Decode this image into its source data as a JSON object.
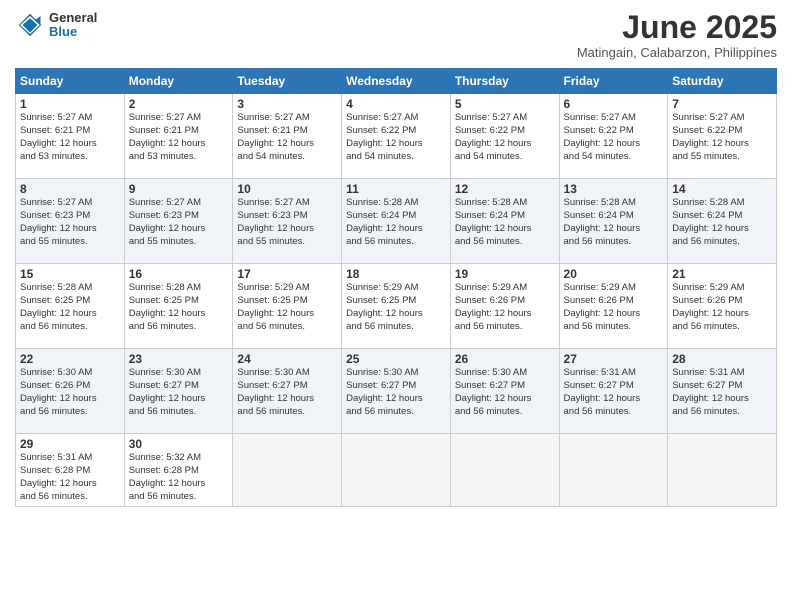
{
  "header": {
    "logo_general": "General",
    "logo_blue": "Blue",
    "month_title": "June 2025",
    "location": "Matingain, Calabarzon, Philippines"
  },
  "days_of_week": [
    "Sunday",
    "Monday",
    "Tuesday",
    "Wednesday",
    "Thursday",
    "Friday",
    "Saturday"
  ],
  "weeks": [
    [
      {
        "day": "1",
        "sunrise": "5:27 AM",
        "sunset": "6:21 PM",
        "daylight": "12 hours and 53 minutes."
      },
      {
        "day": "2",
        "sunrise": "5:27 AM",
        "sunset": "6:21 PM",
        "daylight": "12 hours and 53 minutes."
      },
      {
        "day": "3",
        "sunrise": "5:27 AM",
        "sunset": "6:21 PM",
        "daylight": "12 hours and 54 minutes."
      },
      {
        "day": "4",
        "sunrise": "5:27 AM",
        "sunset": "6:22 PM",
        "daylight": "12 hours and 54 minutes."
      },
      {
        "day": "5",
        "sunrise": "5:27 AM",
        "sunset": "6:22 PM",
        "daylight": "12 hours and 54 minutes."
      },
      {
        "day": "6",
        "sunrise": "5:27 AM",
        "sunset": "6:22 PM",
        "daylight": "12 hours and 54 minutes."
      },
      {
        "day": "7",
        "sunrise": "5:27 AM",
        "sunset": "6:22 PM",
        "daylight": "12 hours and 55 minutes."
      }
    ],
    [
      {
        "day": "8",
        "sunrise": "5:27 AM",
        "sunset": "6:23 PM",
        "daylight": "12 hours and 55 minutes."
      },
      {
        "day": "9",
        "sunrise": "5:27 AM",
        "sunset": "6:23 PM",
        "daylight": "12 hours and 55 minutes."
      },
      {
        "day": "10",
        "sunrise": "5:27 AM",
        "sunset": "6:23 PM",
        "daylight": "12 hours and 55 minutes."
      },
      {
        "day": "11",
        "sunrise": "5:28 AM",
        "sunset": "6:24 PM",
        "daylight": "12 hours and 56 minutes."
      },
      {
        "day": "12",
        "sunrise": "5:28 AM",
        "sunset": "6:24 PM",
        "daylight": "12 hours and 56 minutes."
      },
      {
        "day": "13",
        "sunrise": "5:28 AM",
        "sunset": "6:24 PM",
        "daylight": "12 hours and 56 minutes."
      },
      {
        "day": "14",
        "sunrise": "5:28 AM",
        "sunset": "6:24 PM",
        "daylight": "12 hours and 56 minutes."
      }
    ],
    [
      {
        "day": "15",
        "sunrise": "5:28 AM",
        "sunset": "6:25 PM",
        "daylight": "12 hours and 56 minutes."
      },
      {
        "day": "16",
        "sunrise": "5:28 AM",
        "sunset": "6:25 PM",
        "daylight": "12 hours and 56 minutes."
      },
      {
        "day": "17",
        "sunrise": "5:29 AM",
        "sunset": "6:25 PM",
        "daylight": "12 hours and 56 minutes."
      },
      {
        "day": "18",
        "sunrise": "5:29 AM",
        "sunset": "6:25 PM",
        "daylight": "12 hours and 56 minutes."
      },
      {
        "day": "19",
        "sunrise": "5:29 AM",
        "sunset": "6:26 PM",
        "daylight": "12 hours and 56 minutes."
      },
      {
        "day": "20",
        "sunrise": "5:29 AM",
        "sunset": "6:26 PM",
        "daylight": "12 hours and 56 minutes."
      },
      {
        "day": "21",
        "sunrise": "5:29 AM",
        "sunset": "6:26 PM",
        "daylight": "12 hours and 56 minutes."
      }
    ],
    [
      {
        "day": "22",
        "sunrise": "5:30 AM",
        "sunset": "6:26 PM",
        "daylight": "12 hours and 56 minutes."
      },
      {
        "day": "23",
        "sunrise": "5:30 AM",
        "sunset": "6:27 PM",
        "daylight": "12 hours and 56 minutes."
      },
      {
        "day": "24",
        "sunrise": "5:30 AM",
        "sunset": "6:27 PM",
        "daylight": "12 hours and 56 minutes."
      },
      {
        "day": "25",
        "sunrise": "5:30 AM",
        "sunset": "6:27 PM",
        "daylight": "12 hours and 56 minutes."
      },
      {
        "day": "26",
        "sunrise": "5:30 AM",
        "sunset": "6:27 PM",
        "daylight": "12 hours and 56 minutes."
      },
      {
        "day": "27",
        "sunrise": "5:31 AM",
        "sunset": "6:27 PM",
        "daylight": "12 hours and 56 minutes."
      },
      {
        "day": "28",
        "sunrise": "5:31 AM",
        "sunset": "6:27 PM",
        "daylight": "12 hours and 56 minutes."
      }
    ],
    [
      {
        "day": "29",
        "sunrise": "5:31 AM",
        "sunset": "6:28 PM",
        "daylight": "12 hours and 56 minutes."
      },
      {
        "day": "30",
        "sunrise": "5:32 AM",
        "sunset": "6:28 PM",
        "daylight": "12 hours and 56 minutes."
      },
      null,
      null,
      null,
      null,
      null
    ]
  ]
}
